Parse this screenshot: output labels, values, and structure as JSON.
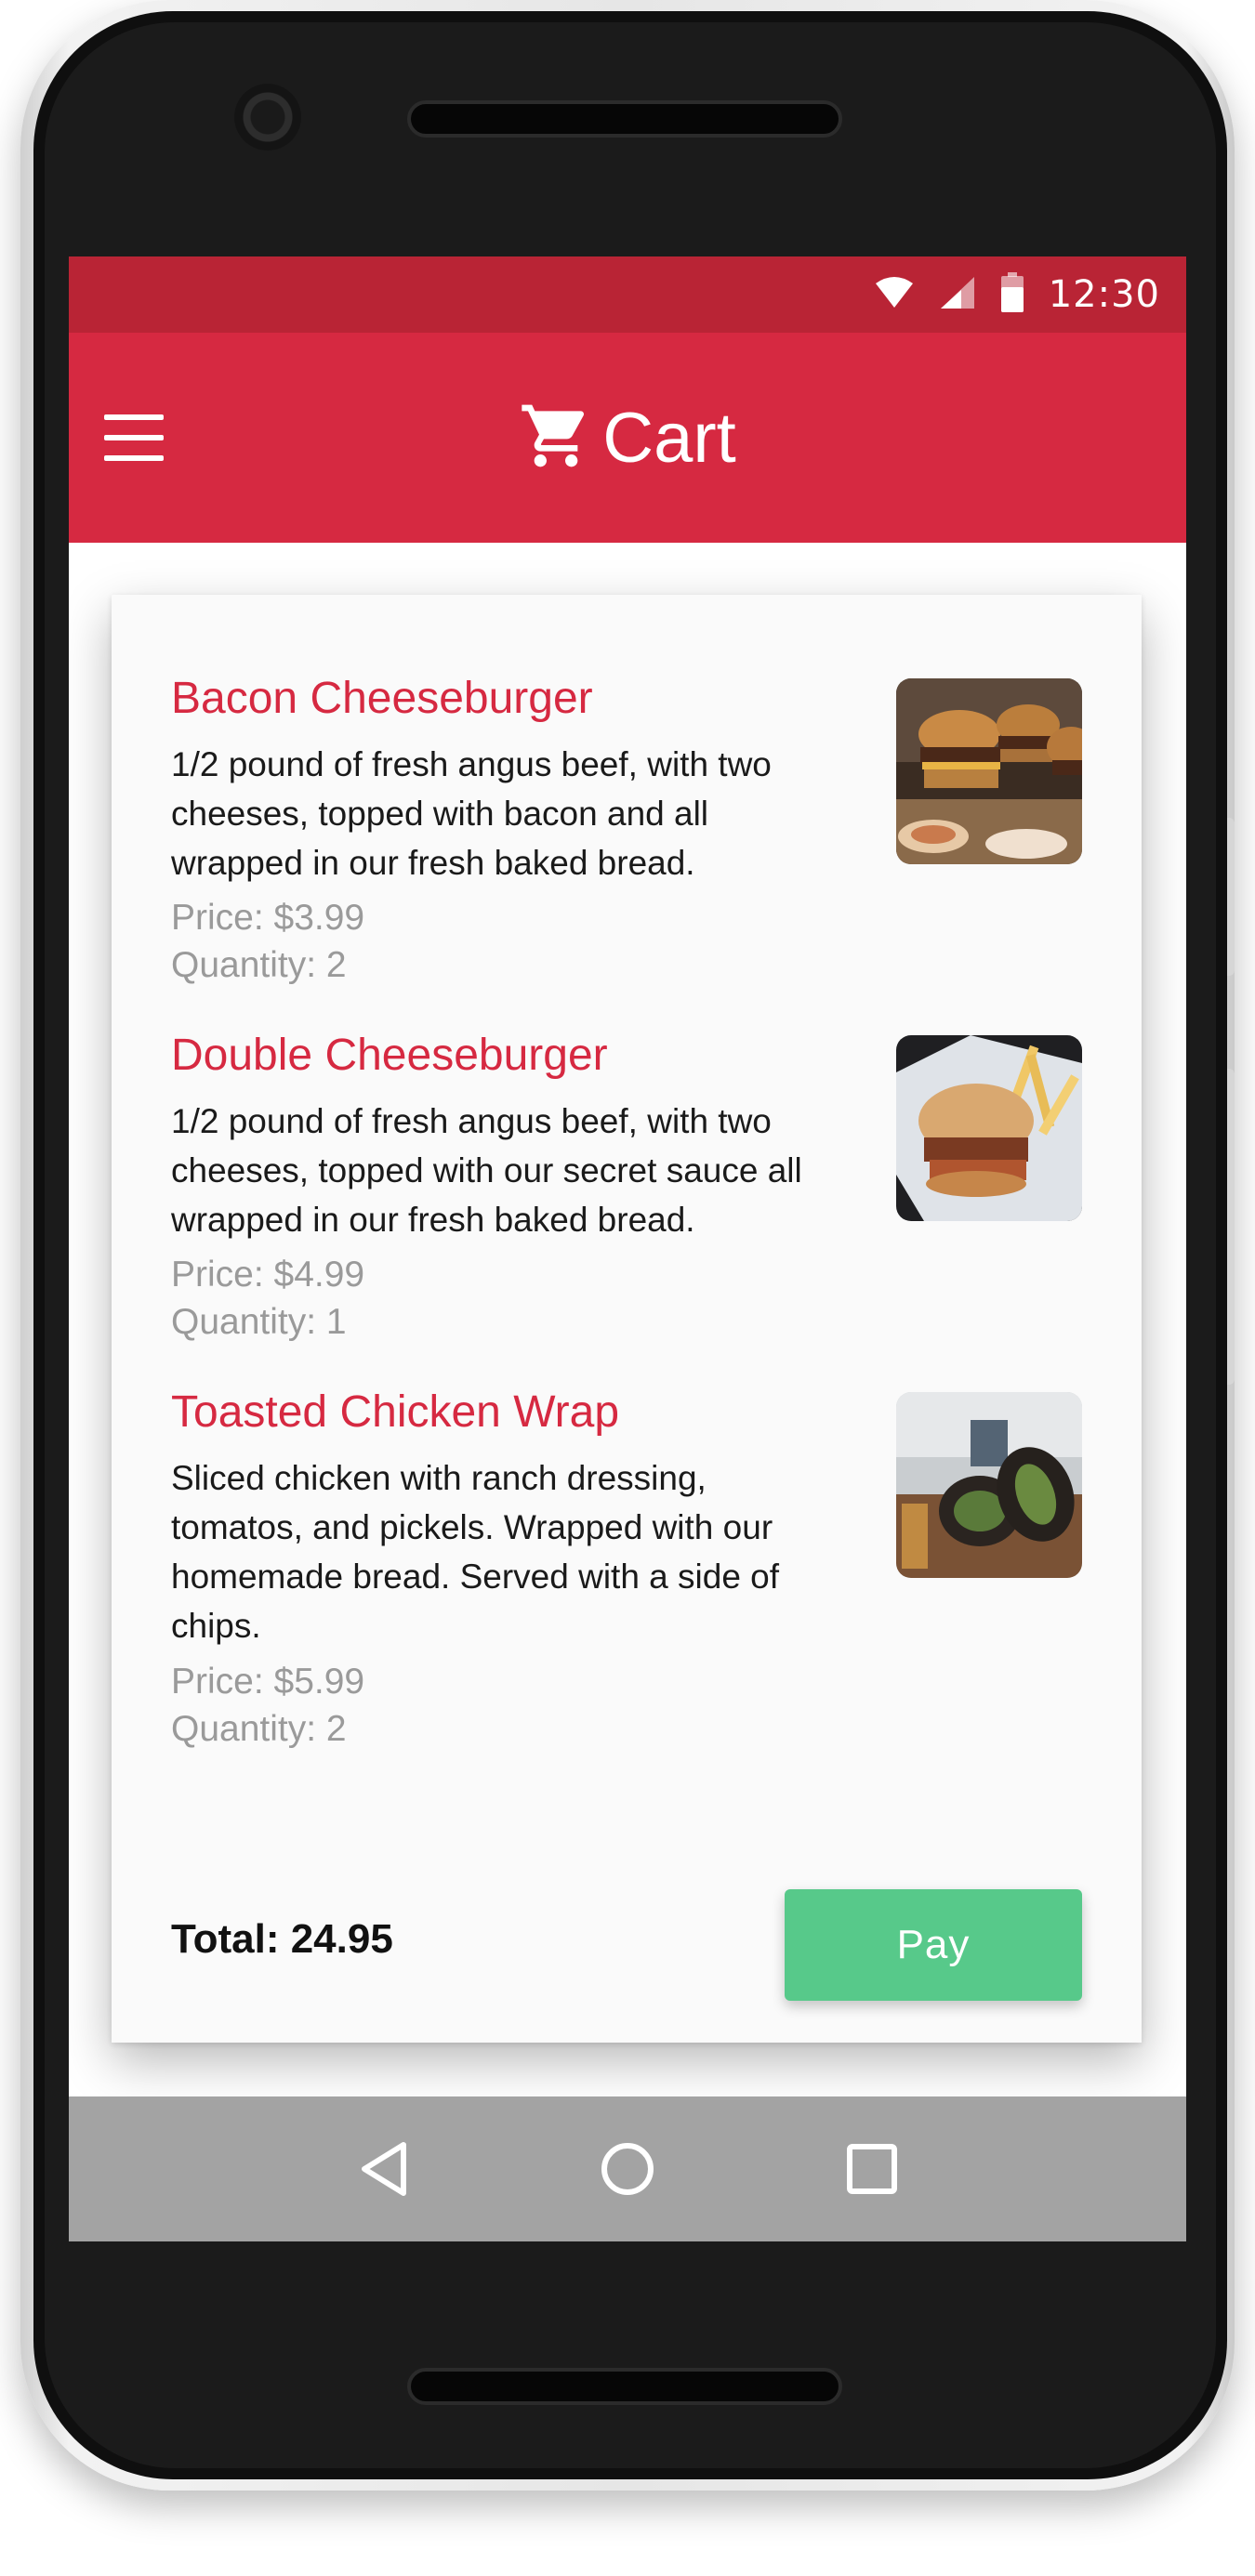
{
  "statusbar": {
    "time": "12:30"
  },
  "appbar": {
    "title": "Cart"
  },
  "cart": {
    "items": [
      {
        "name": "Bacon Cheeseburger",
        "description": "1/2 pound of fresh angus beef, with two cheeses, topped with bacon and all wrapped in our fresh baked bread.",
        "price": "Price: $3.99",
        "quantity": "Quantity: 2"
      },
      {
        "name": "Double Cheeseburger",
        "description": "1/2 pound of fresh angus beef, with two cheeses, topped with our secret sauce all wrapped in our fresh baked bread.",
        "price": "Price: $4.99",
        "quantity": "Quantity: 1"
      },
      {
        "name": "Toasted Chicken Wrap",
        "description": "Sliced chicken with ranch dressing, tomatos, and pickels. Wrapped with our homemade bread. Served with a side of chips.",
        "price": "Price: $5.99",
        "quantity": "Quantity: 2"
      }
    ],
    "total": "Total: 24.95",
    "pay_label": "Pay"
  },
  "colors": {
    "statusbar": "#b92435",
    "appbar": "#d62941",
    "accent_text": "#d62941",
    "pay_button": "#57c98a",
    "navbar": "#a3a3a3"
  },
  "icons": {
    "status": [
      "wifi-icon",
      "signal-icon",
      "battery-icon"
    ],
    "appbar": [
      "hamburger-menu-icon",
      "shopping-cart-icon"
    ],
    "navigation": [
      "back-icon",
      "home-icon",
      "recents-icon"
    ]
  }
}
